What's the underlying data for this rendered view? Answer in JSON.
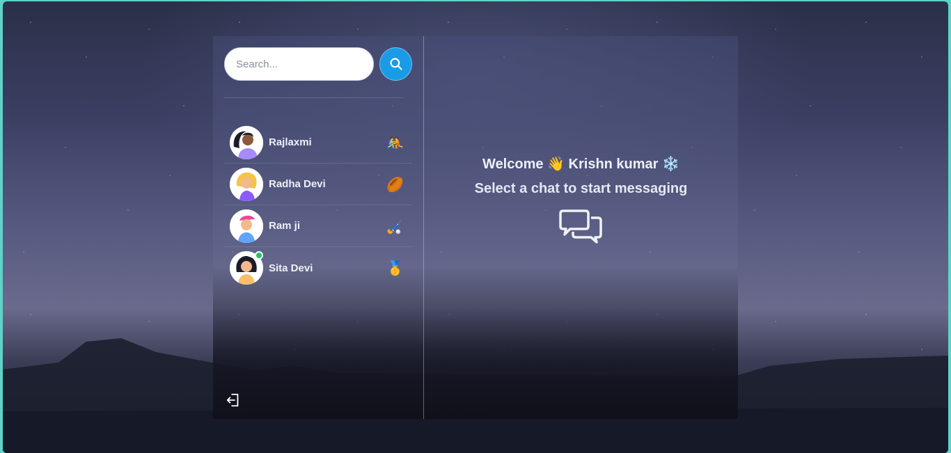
{
  "search": {
    "placeholder": "Search..."
  },
  "conversations": [
    {
      "name": "Rajlaxmi",
      "emoji": "🤼",
      "online": false,
      "avatar": "woman-avatar-purple"
    },
    {
      "name": "Radha Devi",
      "emoji": "🏉",
      "online": false,
      "avatar": "woman-avatar-blonde"
    },
    {
      "name": "Ram ji",
      "emoji": "🏑",
      "online": false,
      "avatar": "man-avatar-cap"
    },
    {
      "name": "Sita Devi",
      "emoji": "🥇",
      "online": true,
      "avatar": "woman-avatar-orange"
    }
  ],
  "welcome": {
    "greeting": "Welcome",
    "wave": "👋",
    "user": "Krishn kumar",
    "snow": "❄️",
    "subtitle": "Select a chat to start messaging"
  },
  "icons": {
    "search": "search-icon",
    "logout": "logout-icon",
    "chat": "chat-bubbles-icon"
  },
  "colors": {
    "accent": "#1a9be6",
    "online": "#22c55e"
  }
}
